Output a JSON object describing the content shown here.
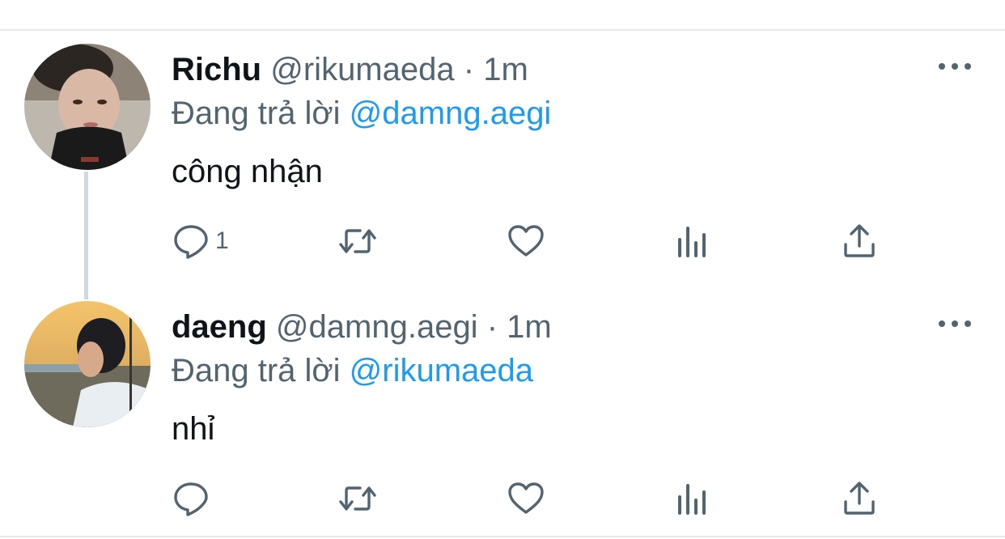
{
  "thread": [
    {
      "avatar_icon": "user-avatar-photo",
      "display_name": "Richu",
      "handle": "@rikumaeda",
      "separator": "·",
      "time": "1m",
      "reply_prefix": "Đang trả lời",
      "reply_to": "@damng.aegi",
      "text": "công nhận",
      "reply_count": "1"
    },
    {
      "avatar_icon": "user-avatar-photo",
      "display_name": "daeng",
      "handle": "@damng.aegi",
      "separator": "·",
      "time": "1m",
      "reply_prefix": "Đang trả lời",
      "reply_to": "@rikumaeda",
      "text": "nhỉ",
      "reply_count": ""
    }
  ],
  "icons": {
    "reply": "reply-icon",
    "retweet": "retweet-icon",
    "like": "heart-icon",
    "views": "views-icon",
    "share": "share-icon",
    "more": "more-dots-icon"
  },
  "colors": {
    "text_primary": "#0f1419",
    "text_secondary": "#536471",
    "mention": "#1d9bf0",
    "divider": "#e6e8ea",
    "thread_line": "#cfd9de"
  }
}
